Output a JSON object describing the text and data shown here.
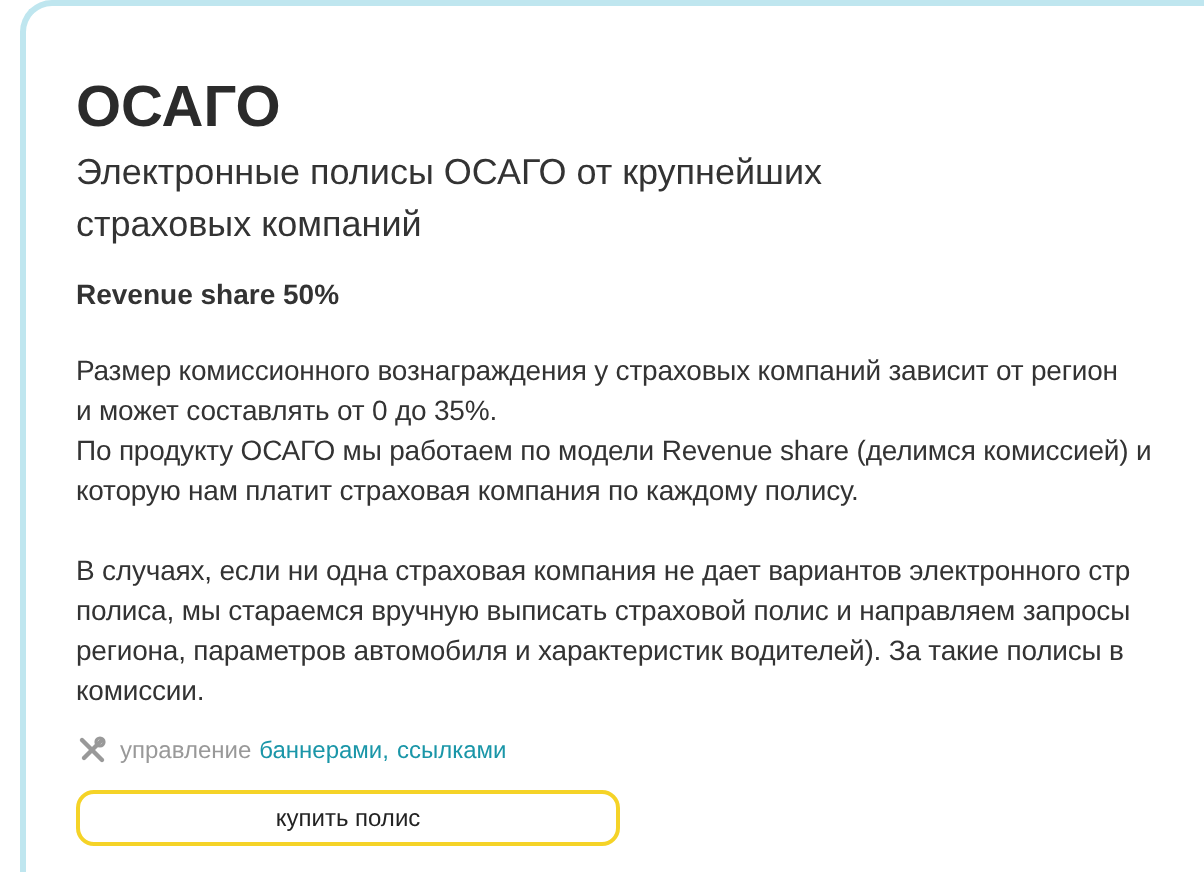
{
  "title": "ОСАГО",
  "subtitle": "Электронные полисы ОСАГО от крупнейших страховых компаний",
  "offer": "Revenue share 50%",
  "paragraphs": [
    {
      "lines": [
        "Размер комиссионного вознаграждения у страховых компаний зависит от регион",
        "и может составлять от 0 до 35%.",
        "По продукту ОСАГО мы работаем по модели Revenue share (делимся комиссией) и",
        "которую нам платит страховая компания по каждому полису."
      ]
    },
    {
      "lines": [
        "В случаях, если ни одна страховая компания не дает вариантов электронного стр",
        "полиса, мы стараемся вручную выписать страховой полис и направляем запросы",
        "региона, параметров автомобиля и характеристик водителей). За такие полисы в",
        "комиссии."
      ]
    }
  ],
  "manage": {
    "label": "управление",
    "links": [
      "баннерами,",
      "ссылками"
    ]
  },
  "button": "купить полис"
}
